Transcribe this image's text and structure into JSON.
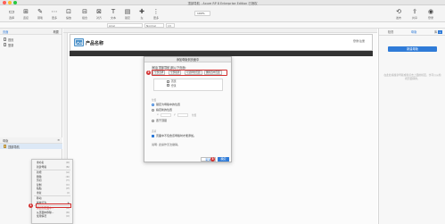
{
  "window": {
    "title": "顶部导航 - Axure RP 8 Enterprise Edition 已授权"
  },
  "toolbar": {
    "items": [
      {
        "icon": "▭",
        "label": "选择",
        "name": "select-tool"
      },
      {
        "icon": "⊞",
        "label": "连接",
        "name": "connect-tool"
      },
      {
        "icon": "✎",
        "label": "钢笔",
        "name": "pen-tool"
      },
      {
        "icon": "⋯",
        "label": "更多",
        "name": "more-tool"
      },
      {
        "icon": "⊡",
        "label": "缩放",
        "name": "scale-tool"
      },
      {
        "icon": "⊟",
        "label": "组合",
        "name": "group-tool"
      },
      {
        "icon": "⊠",
        "label": "对齐",
        "name": "align-tool"
      },
      {
        "icon": "T",
        "label": "文本",
        "name": "text-tool"
      },
      {
        "icon": "▤",
        "label": "锁定",
        "name": "lock-tool"
      },
      {
        "icon": "✚",
        "label": "左",
        "name": "left-tool"
      },
      {
        "icon": "⋮",
        "label": "更多",
        "name": "more2-tool"
      }
    ],
    "zoom": "100%",
    "right_items": [
      {
        "icon": "⟲",
        "label": "发布"
      },
      {
        "icon": "⇪",
        "label": "共享"
      },
      {
        "icon": "◉",
        "label": "登录"
      }
    ]
  },
  "formatbar": {
    "font": "Arial",
    "style": "Normal",
    "size": "13"
  },
  "left_panel": {
    "pages_title": "页面",
    "pages_tab2": "概要",
    "pages": [
      "首页",
      "登录"
    ],
    "masters_title": "母版",
    "masters": [
      "顶部导航"
    ]
  },
  "canvas": {
    "product_name": "产品名称",
    "login_text": "登录/注册"
  },
  "dialog": {
    "title": "添加母版到页面中",
    "instruction": "添加[顶部导航]到以下页面:",
    "chips": [
      "全部选择",
      "全部取消",
      "可选择的页面",
      "删除选中页面"
    ],
    "step_badge": "2",
    "pages": [
      {
        "label": "首页",
        "checked": false
      },
      {
        "label": "登录",
        "checked": false
      }
    ],
    "position_title": "位置",
    "pos_options": [
      {
        "label": "锁定为母版中的位置",
        "selected": true
      },
      {
        "label": "指定新的位置",
        "selected": false
      }
    ],
    "coord_x_label": "x:",
    "coord_y_label": "y:",
    "coord_hint": "位置",
    "front_label": "置于顶层",
    "options_title": "选项",
    "option_check": "页面中不包含该母版时才能添加。",
    "note": "说明: 此操作无法撤销。",
    "cancel_label": "取消",
    "ok_label": "确定"
  },
  "right_panel": {
    "tabs": [
      "检视",
      "母版",
      "库"
    ],
    "active_tab": "母版",
    "add_button": "新建母版",
    "note": "在此处拖拽新母版或者点击上面的按钮，也可以从检视页面转换。"
  },
  "context_menu": {
    "items": [
      {
        "label": "重命名",
        "shortcut": "(R)",
        "red": false
      },
      {
        "label": "新建母版",
        "shortcut": "(N)",
        "red": false
      },
      {
        "label": "新增",
        "shortcut": "(A)",
        "red": false
      },
      {
        "label": "删除",
        "shortcut": "(D)",
        "red": false
      },
      {
        "label": "剪切",
        "shortcut": "(T)",
        "red": false
      },
      {
        "label": "复制",
        "shortcut": "(C)",
        "red": false
      },
      {
        "label": "粘贴",
        "shortcut": "(P)",
        "red": false
      },
      {
        "label": "重复",
        "shortcut": "(I)",
        "red": false
      },
      {
        "label": "移动",
        "shortcut": "",
        "red": false
      },
      {
        "label": "拖放行为",
        "shortcut": "▶",
        "red": false
      },
      {
        "label": "添加到页面中...",
        "shortcut": "(A)",
        "red": true
      },
      {
        "label": "从页面中移除...",
        "shortcut": "(R)",
        "red": false
      },
      {
        "label": "使用情况",
        "shortcut": "(U)",
        "red": false
      }
    ],
    "badge": "1"
  }
}
